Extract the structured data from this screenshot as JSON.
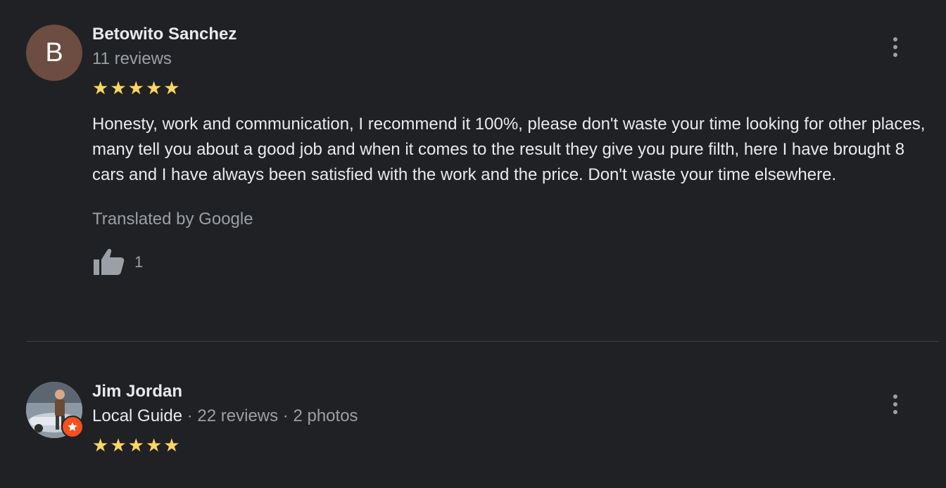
{
  "reviews": [
    {
      "avatar_letter": "B",
      "avatar_color": "#6d4c41",
      "name": "Betowito Sanchez",
      "meta": "11 reviews",
      "rating": 5,
      "text": "Honesty, work and communication, I recommend it 100%, please don't waste your time looking for other places, many tell you about a good job and when it comes to the result they give you pure filth, here I have brought 8 cars and I have always been satisfied with the work and the price. Don't waste your time elsewhere.",
      "translated_label": "Translated by Google",
      "like_count": "1"
    },
    {
      "name": "Jim Jordan",
      "guide_label": "Local Guide",
      "separator": " · ",
      "review_count": "22 reviews",
      "photo_count": "2 photos",
      "rating": 5
    }
  ],
  "colors": {
    "background": "#202124",
    "star": "#fdd663",
    "secondary_text": "#9aa0a6",
    "guide_badge": "#f4511e"
  },
  "icons": {
    "more": "vertical-ellipsis-icon",
    "like": "thumbs-up-icon",
    "star": "star-icon",
    "guide": "local-guide-star-icon"
  }
}
